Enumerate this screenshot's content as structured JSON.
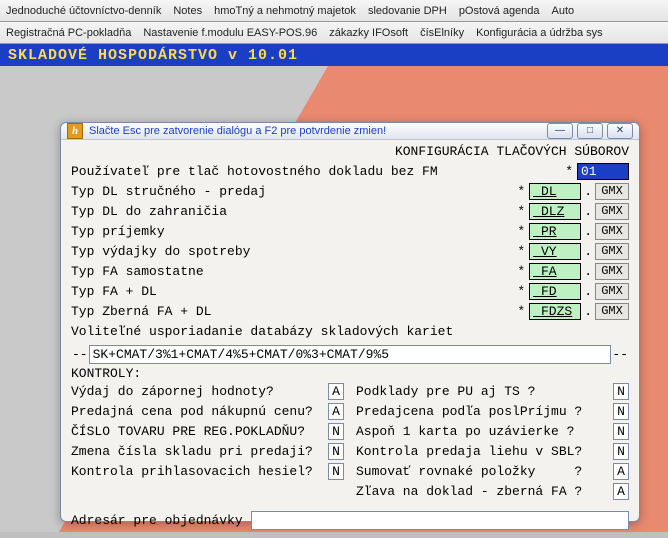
{
  "menubar": {
    "items": [
      "Jednoduché účtovníctvo-denník",
      "Notes",
      "hmoTný a nehmotný majetok",
      "sledovanie DPH",
      "pOstová agenda",
      "Auto",
      "Registračná PC-pokladňa",
      "Nastavenie f.modulu EASY-POS.96",
      "zákazky IFOsoft",
      "čísElníky",
      "Konfigurácia a údržba sys"
    ]
  },
  "titlebar": {
    "text": "SKLADOVÉ HOSPODÁRSTVO v 10.01"
  },
  "dialog": {
    "caption": "Slačte Esc pre zatvorenie dialógu a F2 pre potvrdenie zmien!",
    "header": "KONFIGURÁCIA TLAČOVÝCH SÚBOROV",
    "rows": [
      {
        "label": "Používateľ pre tlač hotovostného dokladu bez FM",
        "value": "01",
        "ext": ""
      },
      {
        "label": "Typ DL stručného - predaj",
        "value": "_DL",
        "ext": "GMX"
      },
      {
        "label": "Typ DL do zahraničia",
        "value": "_DLZ",
        "ext": "GMX"
      },
      {
        "label": "Typ príjemky",
        "value": "_PR",
        "ext": "GMX"
      },
      {
        "label": "Typ výdajky do spotreby",
        "value": "_VY",
        "ext": "GMX"
      },
      {
        "label": "Typ FA samostatne",
        "value": "_FA",
        "ext": "GMX"
      },
      {
        "label": "Typ FA + DL",
        "value": "_FD",
        "ext": "GMX"
      },
      {
        "label": "Typ Zberná FA + DL",
        "value": "_FDZS",
        "ext": "GMX"
      }
    ],
    "sort_label": "Voliteľné usporiadanie databázy skladových kariet",
    "sort_value": "SK+CMAT/3%1+CMAT/4%5+CMAT/0%3+CMAT/9%5",
    "ctrl_header": "KONTROLY:",
    "left": [
      {
        "q": "Výdaj do zápornej hodnoty?",
        "a": "A"
      },
      {
        "q": "Predajná cena pod nákupnú cenu?",
        "a": "A"
      },
      {
        "q": "ČÍSLO TOVARU PRE REG.POKLADŇU?",
        "a": "N"
      },
      {
        "q": "Zmena čísla skladu pri predaji?",
        "a": "N"
      },
      {
        "q": "Kontrola prihlasovacich hesiel?",
        "a": "N"
      }
    ],
    "right": [
      {
        "q": "Podklady pre PU aj TS ?",
        "a": "N"
      },
      {
        "q": "Predajcena podľa poslPríjmu ?",
        "a": "N"
      },
      {
        "q": "Aspoň 1 karta po uzávierke ?",
        "a": "N"
      },
      {
        "q": "Kontrola predaja liehu v SBL?",
        "a": "N"
      },
      {
        "q": "Sumovať rovnaké položky     ?",
        "a": "A"
      },
      {
        "q": "Zľava na doklad - zberná FA ?",
        "a": "A"
      }
    ],
    "addr_label": "Adresár pre objednávky",
    "addr_value": ""
  },
  "winbtns": {
    "min": "—",
    "max": "□",
    "close": "✕"
  }
}
